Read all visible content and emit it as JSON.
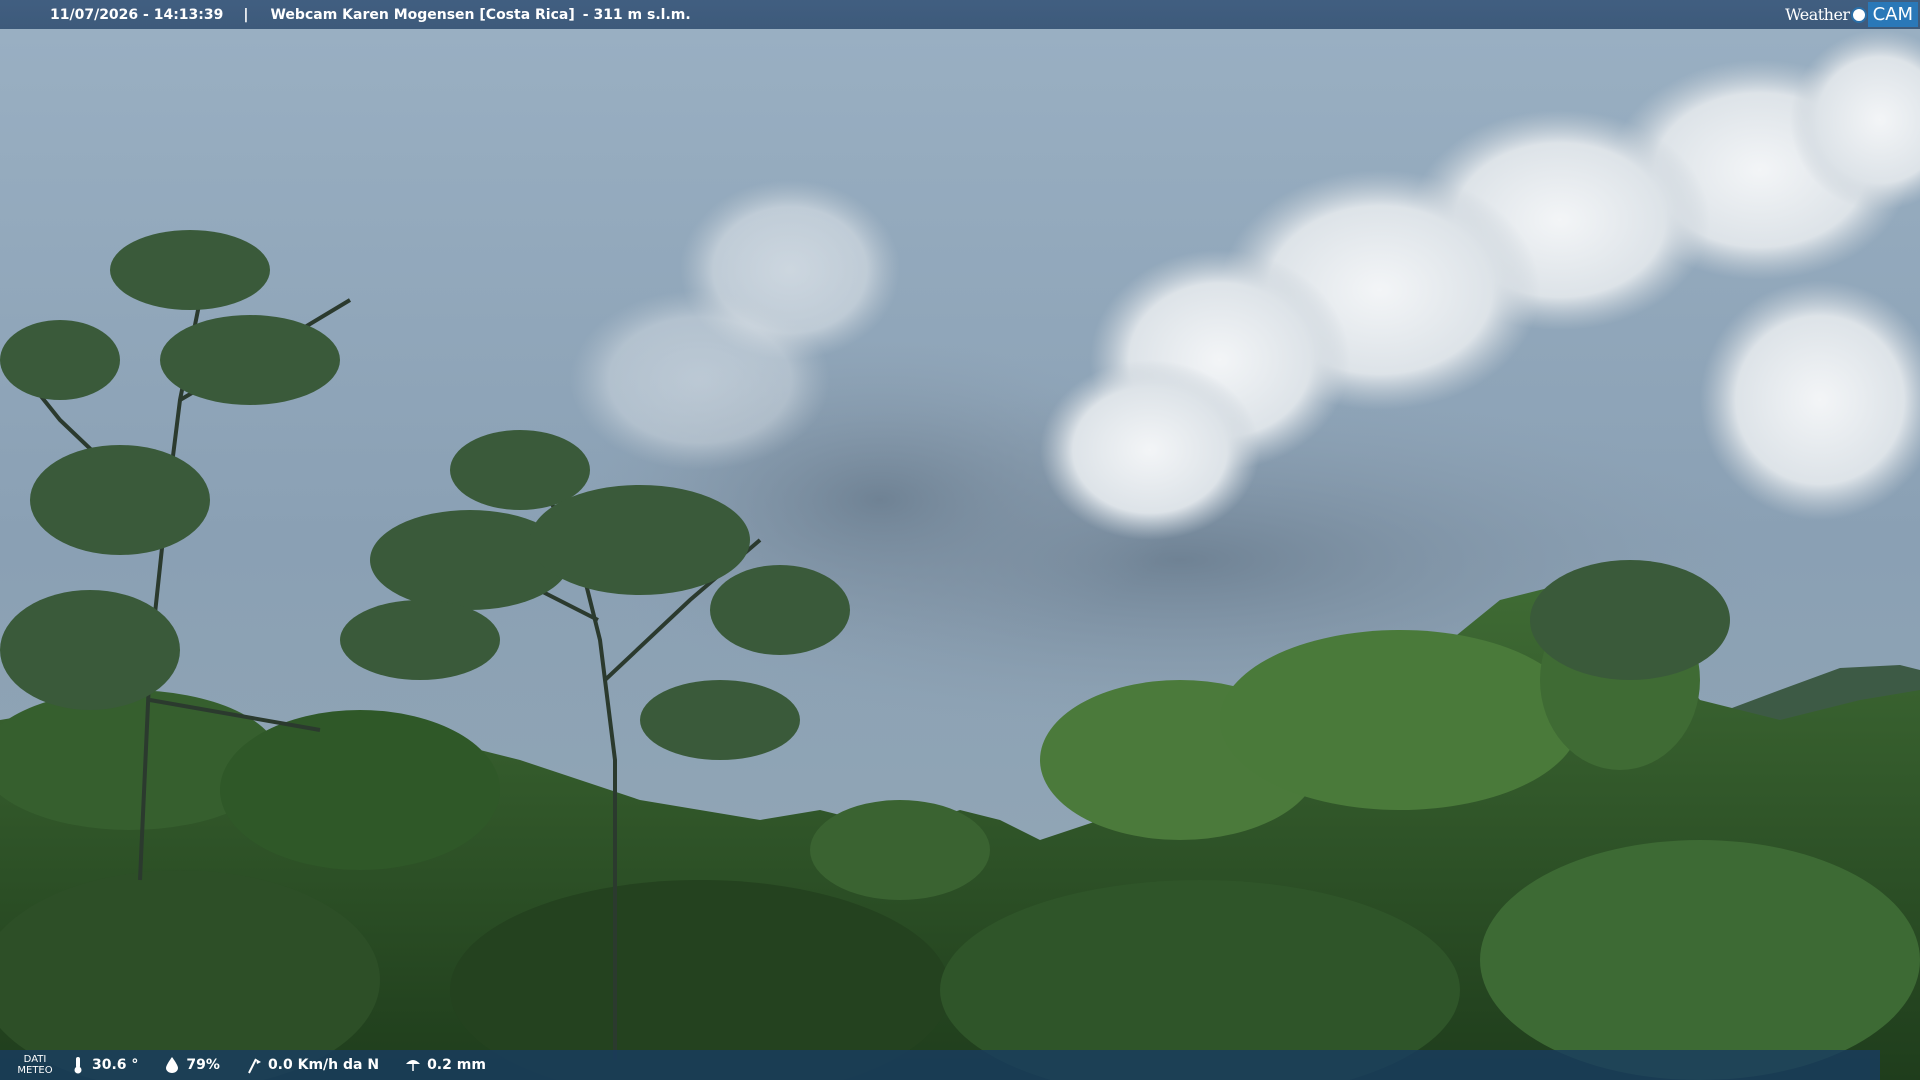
{
  "header": {
    "timestamp": "11/07/2026 - 14:13:39",
    "separator": "|",
    "title": "Webcam Karen Mogensen [Costa Rica]",
    "altitude": "- 311 m s.l.m."
  },
  "logo": {
    "weather": "Weather",
    "cam": "CAM"
  },
  "weather_bar": {
    "label_line1": "DATI",
    "label_line2": "METEO",
    "temperature": "30.6 °",
    "humidity": "79%",
    "wind": "0.0 Km/h da N",
    "rain": "0.2 mm",
    "icons": [
      "thermometer-icon",
      "humidity-icon",
      "wind-icon",
      "rain-icon"
    ]
  },
  "colors": {
    "bar_top": "#3c5a7d",
    "bar_bottom": "#193c5f",
    "logo_accent": "#2a78b8"
  }
}
